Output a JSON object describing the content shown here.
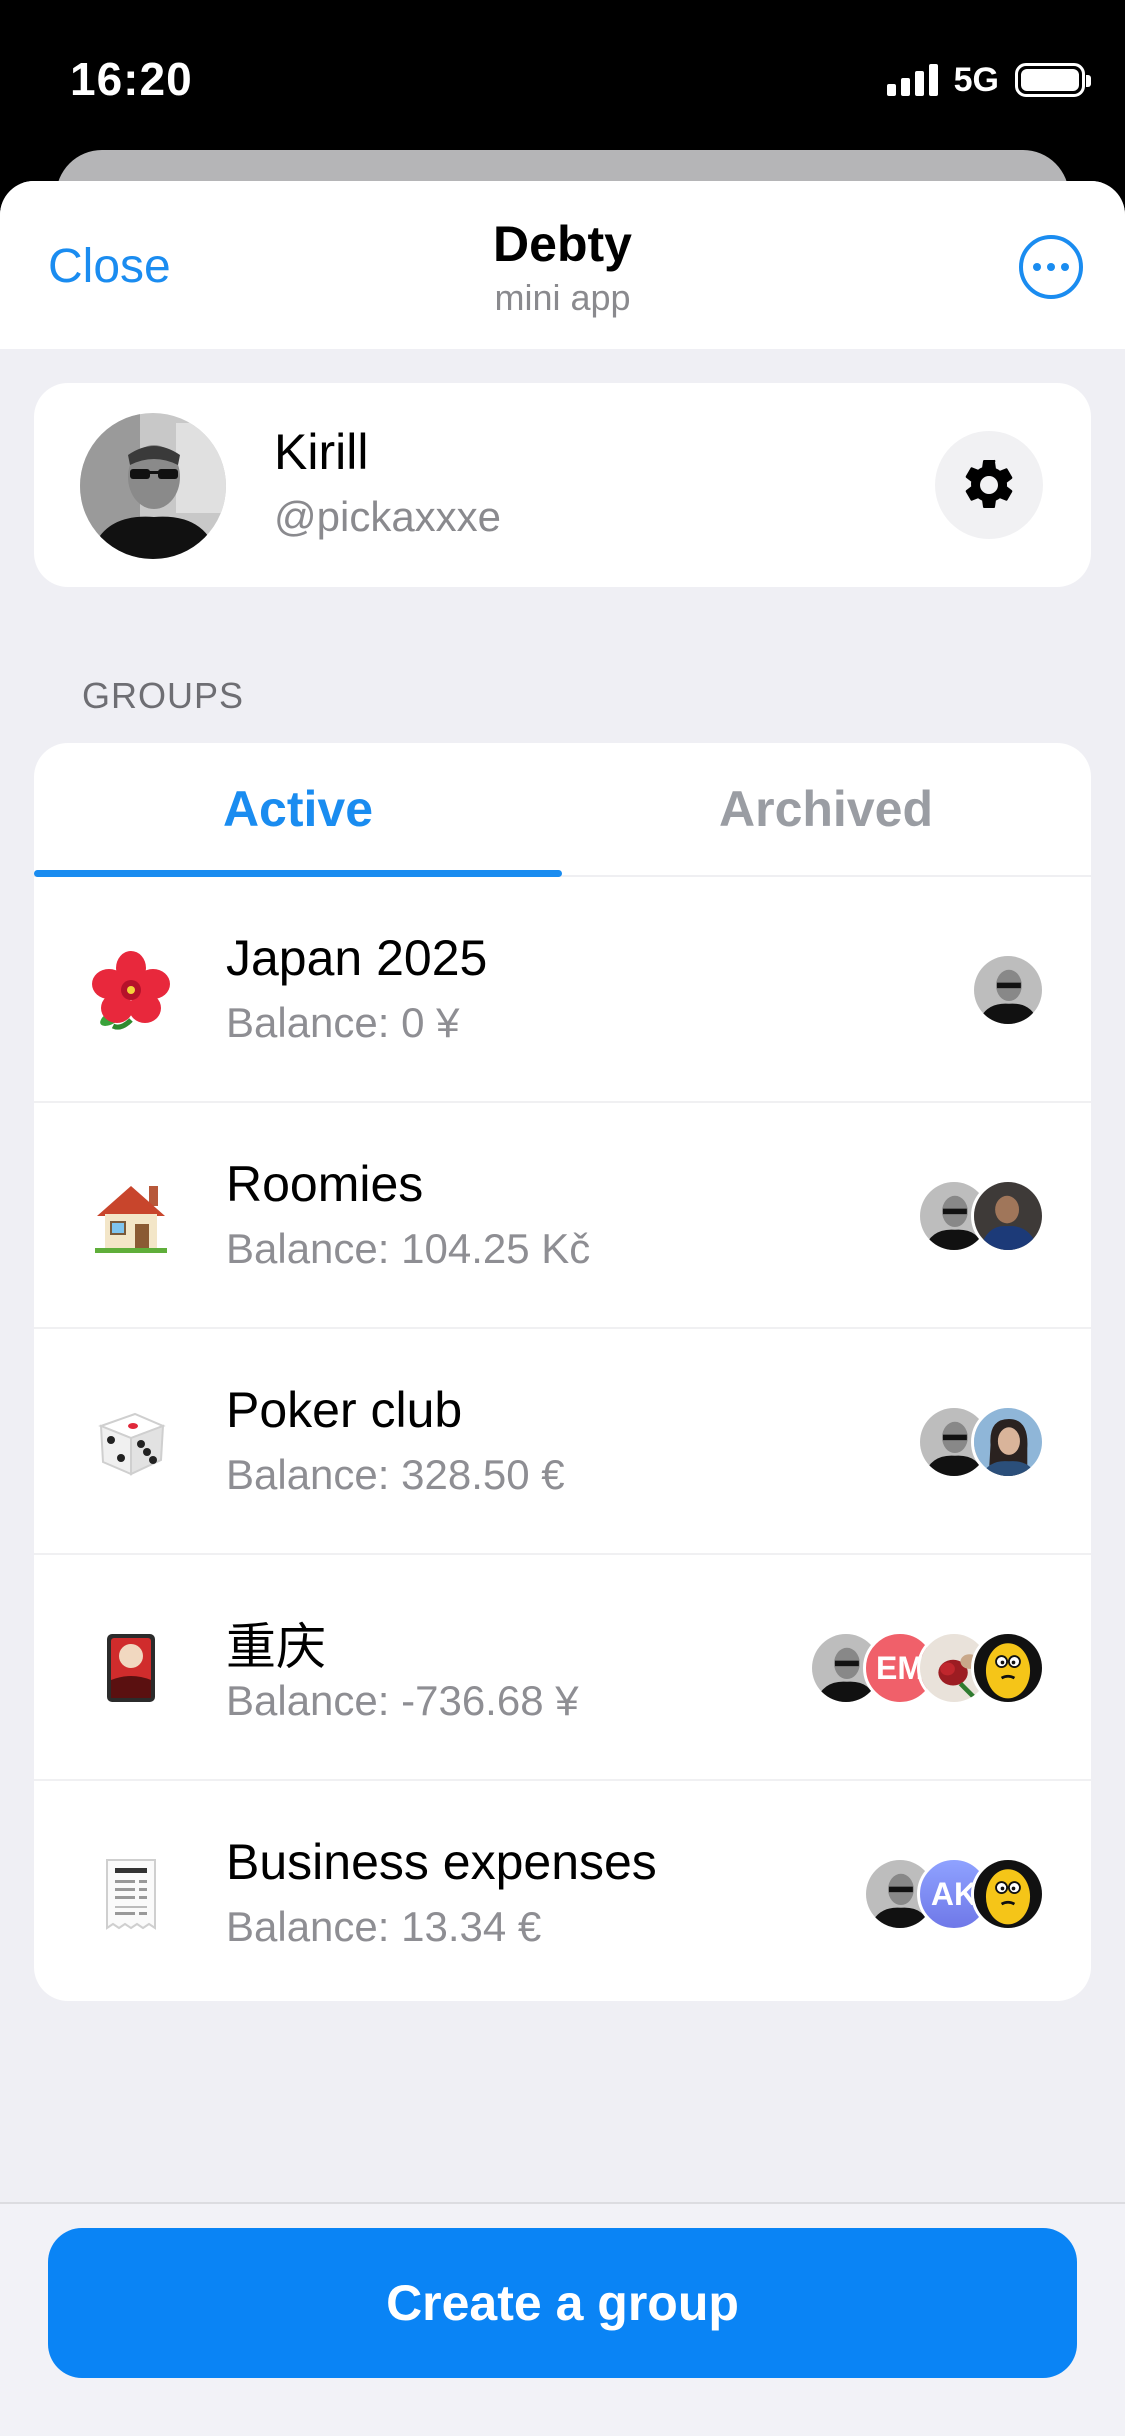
{
  "status_bar": {
    "time": "16:20",
    "network": "5G"
  },
  "header": {
    "close_label": "Close",
    "title": "Debty",
    "subtitle": "mini app",
    "more_icon": "ellipsis-circle-icon"
  },
  "profile": {
    "name": "Kirill",
    "handle": "@pickaxxxe",
    "settings_icon": "gear-icon"
  },
  "groups_section": {
    "label": "GROUPS",
    "tabs": [
      {
        "label": "Active",
        "selected": true
      },
      {
        "label": "Archived",
        "selected": false
      }
    ],
    "items": [
      {
        "emoji": "hibiscus",
        "name": "Japan 2025",
        "balance": "Balance: 0 ¥",
        "members": [
          {
            "type": "photo-bw"
          }
        ]
      },
      {
        "emoji": "house",
        "name": "Roomies",
        "balance": "Balance: 104.25 Kč",
        "members": [
          {
            "type": "photo-bw"
          },
          {
            "type": "photo-dark"
          }
        ]
      },
      {
        "emoji": "die",
        "name": "Poker club",
        "balance": "Balance: 328.50 €",
        "members": [
          {
            "type": "photo-bw"
          },
          {
            "type": "photo-blue"
          }
        ]
      },
      {
        "emoji": "flower-playing-card",
        "name": "重庆",
        "balance": "Balance: -736.68 ¥",
        "members": [
          {
            "type": "photo-bw"
          },
          {
            "type": "initials",
            "initials": "EM",
            "color": "#f0606a"
          },
          {
            "type": "photo-rose"
          },
          {
            "type": "cartoon-yellow"
          }
        ]
      },
      {
        "emoji": "receipt",
        "name": "Business expenses",
        "balance": "Balance: 13.34 €",
        "members": [
          {
            "type": "photo-bw"
          },
          {
            "type": "initials",
            "initials": "AK",
            "color": "#7b8cf6"
          },
          {
            "type": "cartoon-yellow"
          }
        ]
      }
    ]
  },
  "create_button_label": "Create a group",
  "colors": {
    "accent": "#1a8cf0",
    "button": "#0a84f5",
    "background": "#efeff4"
  }
}
